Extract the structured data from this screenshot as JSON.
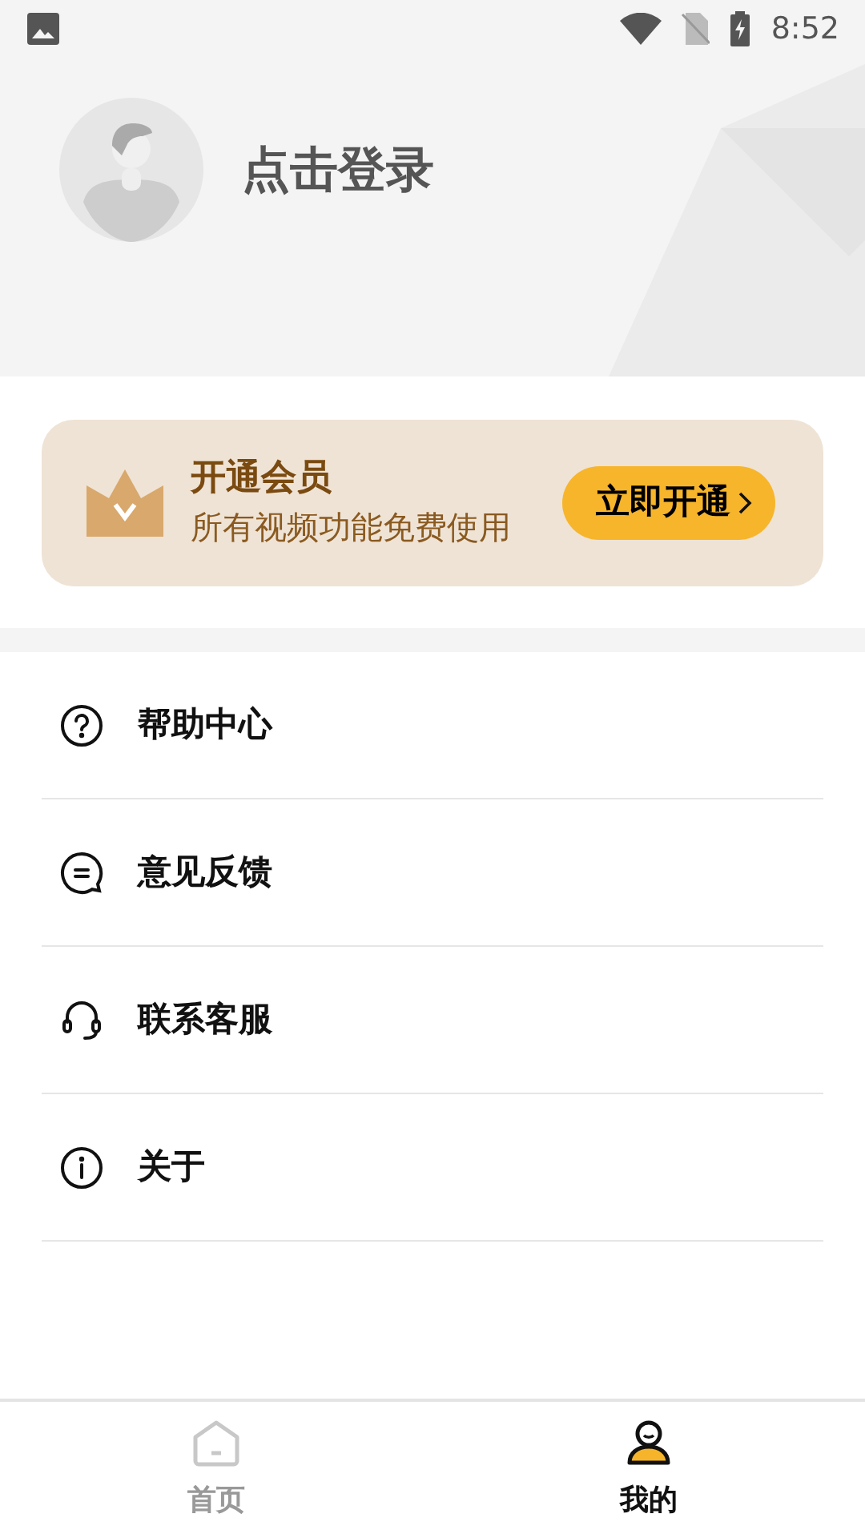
{
  "status_bar": {
    "time": "8:52"
  },
  "profile": {
    "login_text": "点击登录"
  },
  "vip_card": {
    "title": "开通会员",
    "subtitle": "所有视频功能免费使用",
    "button": "立即开通"
  },
  "menu": [
    {
      "kind": "help",
      "label": "帮助中心"
    },
    {
      "kind": "feedback",
      "label": "意见反馈"
    },
    {
      "kind": "service",
      "label": "联系客服"
    },
    {
      "kind": "about",
      "label": "关于"
    }
  ],
  "tabs": [
    {
      "kind": "home",
      "label": "首页",
      "selected": false
    },
    {
      "kind": "mine",
      "label": "我的",
      "selected": true
    }
  ]
}
